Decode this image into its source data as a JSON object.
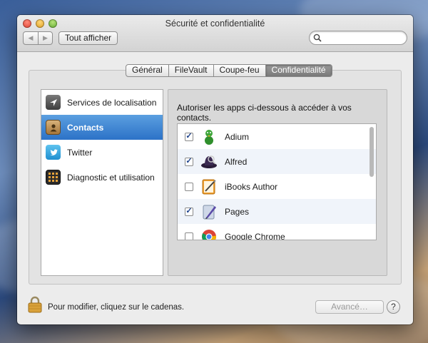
{
  "window": {
    "title": "Sécurité et confidentialité",
    "show_all_label": "Tout afficher",
    "search_placeholder": ""
  },
  "tabs": [
    {
      "label": "Général",
      "active": false
    },
    {
      "label": "FileVault",
      "active": false
    },
    {
      "label": "Coupe-feu",
      "active": false
    },
    {
      "label": "Confidentialité",
      "active": true
    }
  ],
  "sidebar": {
    "items": [
      {
        "label": "Services de localisation",
        "icon": "location-arrow-icon",
        "selected": false
      },
      {
        "label": "Contacts",
        "icon": "contacts-book-icon",
        "selected": true
      },
      {
        "label": "Twitter",
        "icon": "twitter-bird-icon",
        "selected": false
      },
      {
        "label": "Diagnostic et utilisation",
        "icon": "diagnostics-icon",
        "selected": false
      }
    ]
  },
  "main": {
    "prompt": "Autoriser les apps ci-dessous à accéder à vos contacts.",
    "apps": [
      {
        "name": "Adium",
        "checked": true,
        "icon": "adium-duck-icon"
      },
      {
        "name": "Alfred",
        "checked": true,
        "icon": "alfred-hat-icon"
      },
      {
        "name": "iBooks Author",
        "checked": false,
        "icon": "ibooks-author-icon"
      },
      {
        "name": "Pages",
        "checked": true,
        "icon": "pages-pen-icon"
      },
      {
        "name": "Google Chrome",
        "checked": false,
        "icon": "chrome-icon"
      }
    ]
  },
  "footer": {
    "lock_text": "Pour modifier, cliquez sur le cadenas.",
    "advanced_label": "Avancé…",
    "help_label": "?"
  }
}
